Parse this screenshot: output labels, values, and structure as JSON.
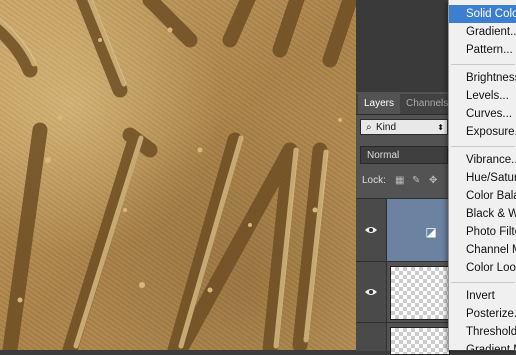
{
  "layers_panel": {
    "tabs": [
      "Layers",
      "Channels"
    ],
    "filter_kind": "Kind",
    "blend_mode": "Normal",
    "lock_label": "Lock:"
  },
  "icons": [
    "search-icon",
    "eye-icon",
    "adjustment-layer-icon",
    "lock-pixels-icon",
    "brush-icon",
    "move-icon"
  ],
  "menu": {
    "items_group1": [
      "Solid Color...",
      "Gradient...",
      "Pattern..."
    ],
    "items_group2": [
      "Brightness/Contrast...",
      "Levels...",
      "Curves...",
      "Exposure..."
    ],
    "items_group3": [
      "Vibrance...",
      "Hue/Saturation...",
      "Color Balance...",
      "Black & White...",
      "Photo Filter...",
      "Channel Mixer...",
      "Color Lookup..."
    ],
    "items_group4": [
      "Invert",
      "Posterize...",
      "Threshold...",
      "Gradient Map..."
    ],
    "selected": "Solid Color..."
  },
  "colors": {
    "menu_highlight": "#3c7fd1",
    "selected_layer": "#6b82a0",
    "panel_bg": "#535353"
  }
}
